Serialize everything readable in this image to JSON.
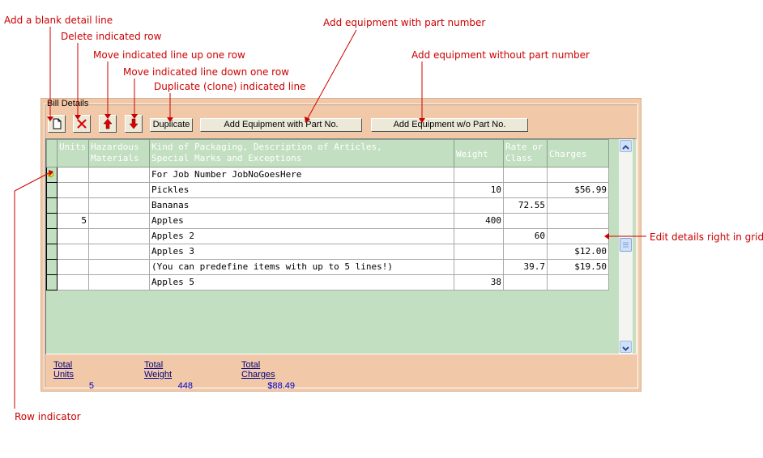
{
  "callouts": {
    "add_blank": "Add a blank detail line",
    "delete_row": "Delete indicated row",
    "move_up": "Move indicated line up one row",
    "move_down": "Move indicated line down one row",
    "duplicate": "Duplicate (clone) indicated line",
    "add_with_part": "Add equipment with part number",
    "add_without_part": "Add equipment without part number",
    "edit_grid": "Edit details right in grid",
    "row_indicator": "Row indicator"
  },
  "panel": {
    "title": "Bill Details"
  },
  "toolbar": {
    "new_icon": "new-document-icon",
    "delete_icon": "delete-x-icon",
    "up_icon": "arrow-up-icon",
    "down_icon": "arrow-down-icon",
    "duplicate_label": "Duplicate",
    "add_with_part_label": "Add Equipment with Part No.",
    "add_without_part_label": "Add Equipment w/o Part No."
  },
  "grid": {
    "headers": {
      "units": "Units",
      "hazardous_1": "Hazardous",
      "hazardous_2": "Materials",
      "desc_1": "Kind of Packaging, Description of Articles,",
      "desc_2": "Special Marks and Exceptions",
      "weight": "Weight",
      "rate_1": "Rate or",
      "rate_2": "Class",
      "charges": "Charges"
    },
    "rows": [
      {
        "units": "",
        "hazardous": "",
        "description": "For Job Number JobNoGoesHere",
        "weight": "",
        "rate": "",
        "charges": ""
      },
      {
        "units": "",
        "hazardous": "",
        "description": "Pickles",
        "weight": "10",
        "rate": "",
        "charges": "$56.99"
      },
      {
        "units": "",
        "hazardous": "",
        "description": "Bananas",
        "weight": "",
        "rate": "72.55",
        "charges": ""
      },
      {
        "units": "5",
        "hazardous": "",
        "description": "Apples",
        "weight": "400",
        "rate": "",
        "charges": ""
      },
      {
        "units": "",
        "hazardous": "",
        "description": "Apples 2",
        "weight": "",
        "rate": "60",
        "charges": ""
      },
      {
        "units": "",
        "hazardous": "",
        "description": "Apples 3",
        "weight": "",
        "rate": "",
        "charges": "$12.00"
      },
      {
        "units": "",
        "hazardous": "",
        "description": "(You can predefine items with up to 5 lines!)",
        "weight": "",
        "rate": "39.7",
        "charges": "$19.50"
      },
      {
        "units": "",
        "hazardous": "",
        "description": "Apples 5",
        "weight": "38",
        "rate": "",
        "charges": ""
      }
    ]
  },
  "totals": {
    "units_label": "Total Units",
    "units_value": "5",
    "weight_label": "Total Weight",
    "weight_value": "448",
    "charges_label": "Total Charges",
    "charges_value": "$88.49"
  },
  "colors": {
    "callout": "#cc0000",
    "panel": "#f2c9a8",
    "grid_bg": "#c2dfc1",
    "totals_value": "#0000cc"
  }
}
